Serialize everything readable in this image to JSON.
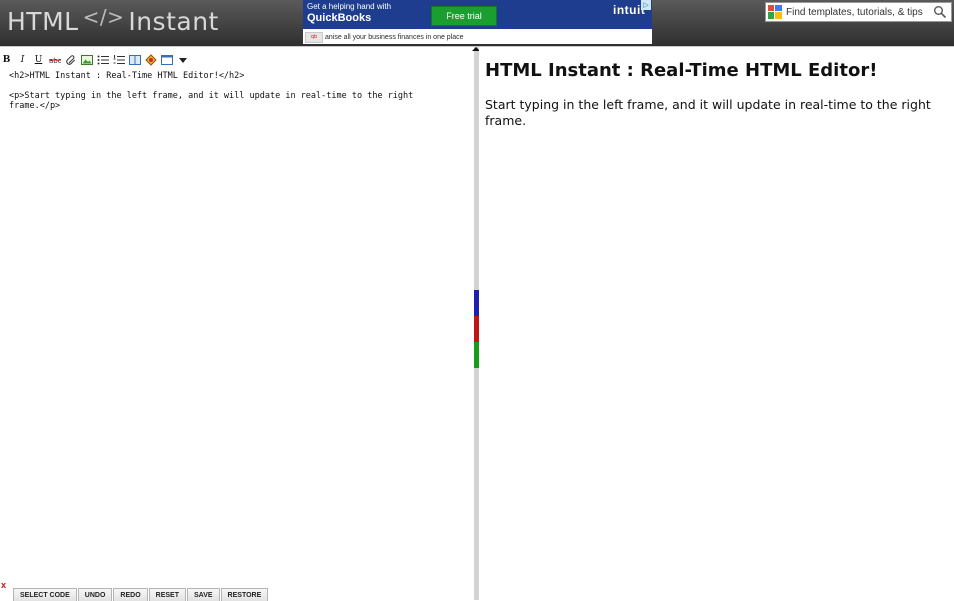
{
  "app": {
    "logo_left": "HTML",
    "logo_mark": "</>",
    "logo_right": "Instant"
  },
  "ad": {
    "line1": "Get a helping hand with",
    "line2": "QuickBooks",
    "cta": "Free trial",
    "brand": "intuit",
    "strap": "anise all your business finances in one place",
    "colors": {
      "top_bg": "#1f3d8f",
      "cta_bg": "#1a9e2f"
    }
  },
  "search": {
    "placeholder": "Find templates, tutorials, & tips"
  },
  "toolbar": {
    "buttons": [
      {
        "name": "bold-button",
        "glyph": "B"
      },
      {
        "name": "italic-button",
        "glyph": "I"
      },
      {
        "name": "underline-button",
        "glyph": "U"
      },
      {
        "name": "strikethrough-button",
        "glyph": "abc"
      },
      {
        "name": "link-button",
        "icon": "paperclip-icon"
      },
      {
        "name": "image-button",
        "icon": "image-icon"
      },
      {
        "name": "unordered-list-button",
        "icon": "bullet-list-icon"
      },
      {
        "name": "ordered-list-button",
        "icon": "numbered-list-icon"
      },
      {
        "name": "table-button",
        "icon": "book-icon"
      },
      {
        "name": "color-button",
        "icon": "palette-icon"
      },
      {
        "name": "preview-button",
        "icon": "window-icon"
      },
      {
        "name": "more-button",
        "icon": "chevron-down-icon"
      }
    ]
  },
  "editor": {
    "code": "<h2>HTML Instant : Real-Time HTML Editor!</h2>\n\n<p>Start typing in the left frame, and it will update in real-time to the right\nframe.</p>"
  },
  "preview": {
    "heading": "HTML Instant : Real-Time HTML Editor!",
    "paragraph": "Start typing in the left frame, and it will update in real-time to the right frame."
  },
  "bottom": {
    "close": "x",
    "buttons": {
      "select_code": "SELECT CODE",
      "undo": "UNDO",
      "redo": "REDO",
      "reset": "RESET",
      "save": "SAVE",
      "restore": "RESTORE"
    }
  },
  "divider": {
    "colors": [
      "#1f1fb0",
      "#c01515",
      "#1c9a1c"
    ]
  }
}
